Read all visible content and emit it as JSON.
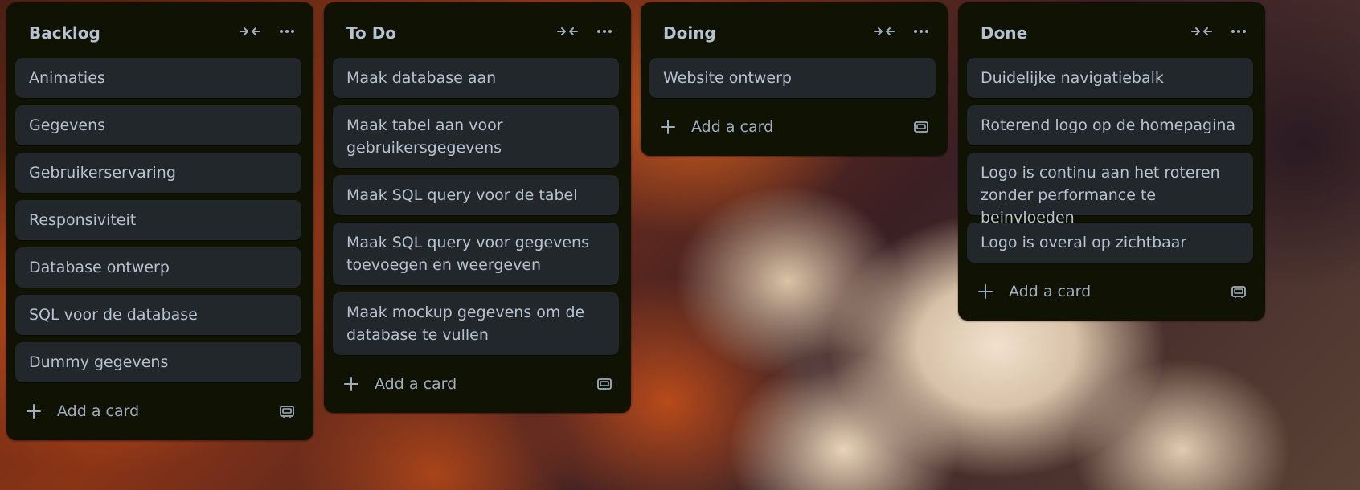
{
  "board": {
    "columns": [
      {
        "title": "Backlog",
        "cards": [
          {
            "lines": [
              "Animaties"
            ]
          },
          {
            "lines": [
              "Gegevens"
            ]
          },
          {
            "lines": [
              "Gebruikerservaring"
            ]
          },
          {
            "lines": [
              "Responsiviteit"
            ]
          },
          {
            "lines": [
              "Database ontwerp"
            ]
          },
          {
            "lines": [
              "SQL voor de database"
            ]
          },
          {
            "lines": [
              "Dummy gegevens"
            ]
          }
        ],
        "add_label": "Add a card"
      },
      {
        "title": "To Do",
        "cards": [
          {
            "lines": [
              "Maak database aan"
            ]
          },
          {
            "lines": [
              "Maak tabel aan voor",
              "gebruikersgegevens"
            ]
          },
          {
            "lines": [
              "Maak SQL query voor de tabel"
            ]
          },
          {
            "lines": [
              "Maak SQL query voor gegevens",
              "toevoegen en weergeven"
            ]
          },
          {
            "lines": [
              "Maak mockup gegevens om de",
              "database te vullen"
            ]
          }
        ],
        "add_label": "Add a card"
      },
      {
        "title": "Doing",
        "cards": [
          {
            "lines": [
              "Website ontwerp"
            ]
          }
        ],
        "add_label": "Add a card"
      },
      {
        "title": "Done",
        "cards": [
          {
            "lines": [
              "Duidelijke navigatiebalk"
            ]
          },
          {
            "lines": [
              "Roterend logo op de homepagina"
            ]
          },
          {
            "lines": [
              "Logo is continu aan het roteren",
              "zonder performance te beinvloeden"
            ]
          },
          {
            "lines": [
              "Logo is overal op zichtbaar"
            ]
          }
        ],
        "add_label": "Add a card"
      }
    ]
  },
  "icons": {
    "collapse": "collapse-arrows-icon",
    "more": "more-dots-icon",
    "add": "plus-icon",
    "template": "card-template-icon"
  },
  "colors": {
    "list_bg": "#101204",
    "card_bg": "#22272b",
    "text": "#b6c2cf",
    "muted_text": "#9fadbc"
  }
}
